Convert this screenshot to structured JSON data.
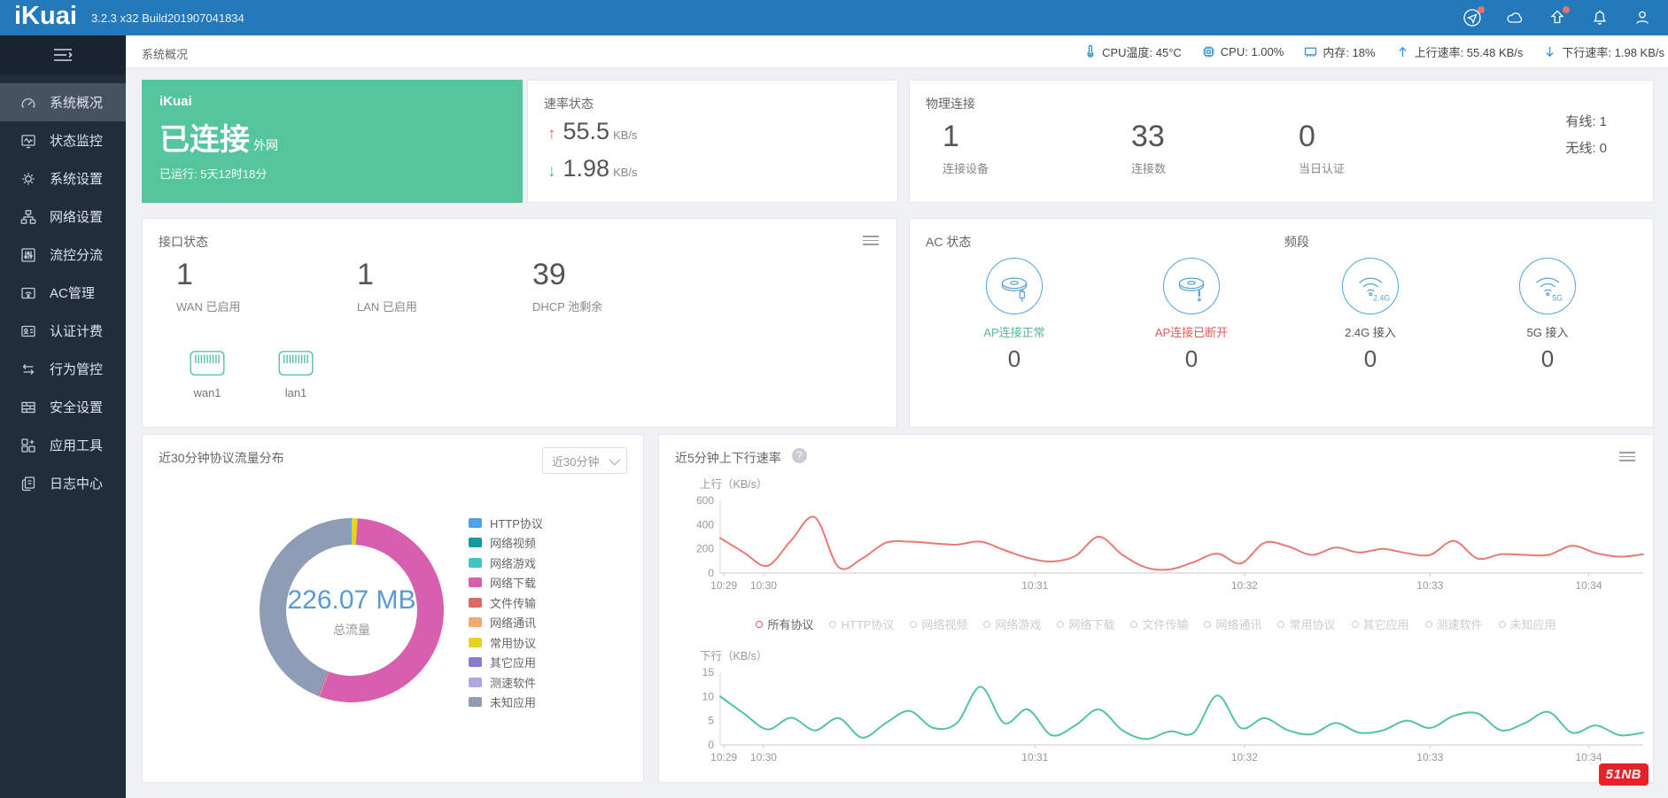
{
  "topbar": {
    "logo": "iKuai",
    "version": "3.2.3 x32 Build201907041834",
    "icons": [
      {
        "name": "send-icon",
        "badge": true
      },
      {
        "name": "cloud-icon",
        "badge": false
      },
      {
        "name": "upgrade-icon",
        "badge": true
      },
      {
        "name": "bell-icon",
        "badge": false
      },
      {
        "name": "user-icon",
        "badge": false
      }
    ]
  },
  "header_status": {
    "breadcrumb": "系统概况",
    "items": [
      {
        "icon": "thermometer-icon",
        "text": "CPU温度: 45°C"
      },
      {
        "icon": "cpu-icon",
        "text": "CPU: 1.00%"
      },
      {
        "icon": "memory-icon",
        "text": "内存: 18%"
      },
      {
        "icon": "up-arrow-icon",
        "text": "上行速率: 55.48 KB/s"
      },
      {
        "icon": "down-arrow-icon",
        "text": "下行速率: 1.98 KB/s"
      }
    ]
  },
  "sidebar": {
    "items": [
      {
        "icon": "gauge-icon",
        "label": "系统概况",
        "active": true
      },
      {
        "icon": "monitor-pulse-icon",
        "label": "状态监控",
        "active": false
      },
      {
        "icon": "gear-icon",
        "label": "系统设置",
        "active": false
      },
      {
        "icon": "network-icon",
        "label": "网络设置",
        "active": false
      },
      {
        "icon": "sliders-icon",
        "label": "流控分流",
        "active": false
      },
      {
        "icon": "wifi-box-icon",
        "label": "AC管理",
        "active": false
      },
      {
        "icon": "id-card-icon",
        "label": "认证计费",
        "active": false
      },
      {
        "icon": "swap-arrows-icon",
        "label": "行为管控",
        "active": false
      },
      {
        "icon": "firewall-icon",
        "label": "安全设置",
        "active": false
      },
      {
        "icon": "tools-icon",
        "label": "应用工具",
        "active": false
      },
      {
        "icon": "logs-icon",
        "label": "日志中心",
        "active": false
      }
    ]
  },
  "connection_card": {
    "brand": "iKuai",
    "status": "已连接",
    "network": "外网",
    "uptime": "已运行: 5天12时18分",
    "bg_color": "#55c59d"
  },
  "rate_card": {
    "title": "速率状态",
    "up_value": "55.5",
    "up_unit": "KB/s",
    "down_value": "1.98",
    "down_unit": "KB/s",
    "up_color": "#e36d6d",
    "down_color": "#4ab897"
  },
  "physical_card": {
    "title": "物理连接",
    "stats": [
      {
        "value": "1",
        "label": "连接设备"
      },
      {
        "value": "33",
        "label": "连接数"
      },
      {
        "value": "0",
        "label": "当日认证"
      }
    ],
    "wired": "有线: 1",
    "wireless": "无线: 0"
  },
  "interface_card": {
    "title": "接口状态",
    "stats": [
      {
        "value": "1",
        "label": "WAN 已启用"
      },
      {
        "value": "1",
        "label": "LAN 已启用"
      },
      {
        "value": "39",
        "label": "DHCP 池剩余"
      }
    ],
    "ports": [
      {
        "label": "wan1"
      },
      {
        "label": "lan1"
      }
    ]
  },
  "ac_card": {
    "title": "AC 状态",
    "band_label": "频段",
    "items": [
      {
        "icon": "ap-connected-icon",
        "label": "AP连接正常",
        "label_color": "#5cb992",
        "value": "0"
      },
      {
        "icon": "ap-disconnected-icon",
        "label": "AP连接已断开",
        "label_color": "#e25b5b",
        "value": "0"
      },
      {
        "icon": "wifi-24g-icon",
        "label": "2.4G 接入",
        "label_color": "#555555",
        "value": "0"
      },
      {
        "icon": "wifi-5g-icon",
        "label": "5G 接入",
        "label_color": "#555555",
        "value": "0"
      }
    ]
  },
  "protocol_card": {
    "title": "近30分钟协议流量分布",
    "dropdown_value": "近30分钟"
  },
  "speed_card": {
    "title": "近5分钟上下行速率",
    "help": "?",
    "legend": {
      "selected": "所有协议",
      "items": [
        "所有协议",
        "HTTP协议",
        "网络视频",
        "网络游戏",
        "网络下载",
        "文件传输",
        "网络通讯",
        "常用协议",
        "其它应用",
        "测速软件",
        "未知应用"
      ]
    }
  },
  "watermark": "51NB",
  "chart_data": [
    {
      "id": "protocol-donut",
      "type": "pie",
      "title": "近30分钟协议流量分布",
      "center_value": "226.07 MB",
      "center_label": "总流量",
      "unit": "MB",
      "total": 226.07,
      "legend_position": "right",
      "segments": [
        {
          "name": "常用协议",
          "value": 2.3,
          "color": "#e5d322"
        },
        {
          "name": "网络下载",
          "value": 123.3,
          "color": "#d85fae"
        },
        {
          "name": "文件传输",
          "value": 0.4,
          "color": "#dd6a62"
        },
        {
          "name": "网络通讯",
          "value": 0.2,
          "color": "#f4a96f"
        },
        {
          "name": "其它应用",
          "value": 0.7,
          "color": "#8b7bd0"
        },
        {
          "name": "测速软件",
          "value": 0.02,
          "color": "#b2a6e2"
        },
        {
          "name": "未知应用",
          "value": 98.5,
          "color": "#8f9cb5"
        },
        {
          "name": "HTTP协议",
          "value": 0.5,
          "color": "#4ea3e8"
        },
        {
          "name": "网络视频",
          "value": 0.1,
          "color": "#0f9d9e"
        },
        {
          "name": "网络游戏",
          "value": 0.05,
          "color": "#3cc7c4"
        }
      ],
      "legend": [
        {
          "label": "HTTP协议",
          "color": "#4ea3e8"
        },
        {
          "label": "网络视频",
          "color": "#0f9d9e"
        },
        {
          "label": "网络游戏",
          "color": "#3cc7c4"
        },
        {
          "label": "网络下载",
          "color": "#d85fae"
        },
        {
          "label": "文件传输",
          "color": "#dd6a62"
        },
        {
          "label": "网络通讯",
          "color": "#f4a96f"
        },
        {
          "label": "常用协议",
          "color": "#e5d322"
        },
        {
          "label": "其它应用",
          "color": "#8b7bd0"
        },
        {
          "label": "测速软件",
          "color": "#b2a6e2"
        },
        {
          "label": "未知应用",
          "color": "#8f9cb5"
        }
      ]
    },
    {
      "id": "up-line",
      "type": "line",
      "ylabel": "上行（KB/s）",
      "color": "#e87a74",
      "ylim": [
        0,
        600
      ],
      "yticks": [
        0,
        200,
        400,
        600
      ],
      "grid": false,
      "xticks": [
        {
          "label": "10:29",
          "f": 0.004
        },
        {
          "label": "10:30",
          "f": 0.047
        },
        {
          "label": "10:31",
          "f": 0.341
        },
        {
          "label": "10:32",
          "f": 0.568
        },
        {
          "label": "10:33",
          "f": 0.769
        },
        {
          "label": "10:34",
          "f": 0.941
        }
      ],
      "values": [
        290,
        170,
        60,
        270,
        460,
        50,
        120,
        250,
        260,
        245,
        235,
        260,
        190,
        125,
        95,
        140,
        300,
        150,
        45,
        30,
        90,
        160,
        80,
        250,
        220,
        150,
        210,
        170,
        200,
        165,
        150,
        265,
        120,
        155,
        150,
        150,
        225,
        165,
        135,
        155
      ]
    },
    {
      "id": "down-line",
      "type": "line",
      "ylabel": "下行（KB/s）",
      "color": "#55c3a0",
      "ylim": [
        0,
        15
      ],
      "yticks": [
        0,
        5,
        10,
        15
      ],
      "grid": false,
      "xticks": [
        {
          "label": "10:29",
          "f": 0.004
        },
        {
          "label": "10:30",
          "f": 0.047
        },
        {
          "label": "10:31",
          "f": 0.341
        },
        {
          "label": "10:32",
          "f": 0.568
        },
        {
          "label": "10:33",
          "f": 0.769
        },
        {
          "label": "10:34",
          "f": 0.941
        }
      ],
      "values": [
        10,
        6.5,
        3.2,
        5.6,
        3.0,
        5.5,
        1.5,
        4.5,
        7.0,
        3.5,
        4.5,
        12.0,
        4.5,
        7.3,
        2.0,
        4.0,
        7.3,
        3.0,
        1.2,
        2.8,
        2.5,
        10.2,
        3.5,
        5.5,
        3.0,
        2.2,
        4.5,
        2.5,
        3.0,
        5.0,
        3.5,
        6.0,
        6.5,
        3.0,
        4.5,
        6.8,
        2.5,
        4.0,
        2.0,
        2.5
      ]
    }
  ]
}
